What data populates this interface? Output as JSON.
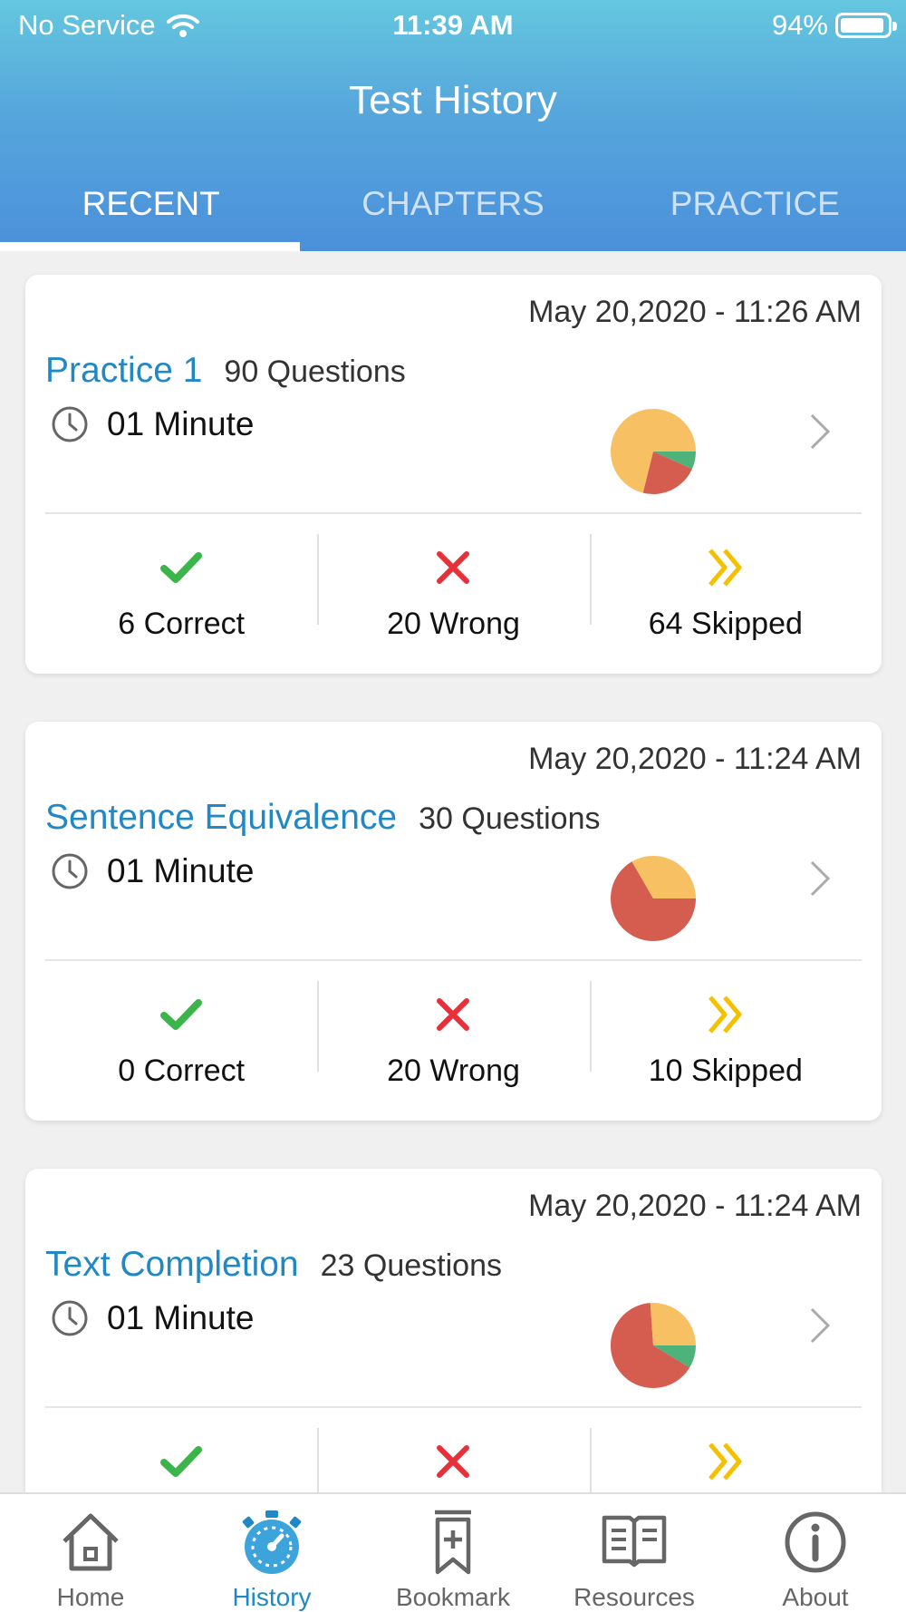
{
  "status": {
    "carrier": "No Service",
    "time": "11:39 AM",
    "battery": "94%",
    "battery_level": 0.94
  },
  "header": {
    "title": "Test History"
  },
  "tabs": [
    {
      "label": "RECENT",
      "active": true
    },
    {
      "label": "CHAPTERS",
      "active": false
    },
    {
      "label": "PRACTICE",
      "active": false
    }
  ],
  "colors": {
    "correct": "#3bb54a",
    "wrong": "#e8303b",
    "skipped": "#f5c000",
    "pie_skipped": "#f6c063",
    "pie_wrong": "#d55d4f",
    "pie_correct": "#4db37a",
    "accent": "#2188c6"
  },
  "tests": [
    {
      "date": "May 20,2020 - 11:26 AM",
      "name": "Practice 1",
      "questions": "90 Questions",
      "duration": "01 Minute",
      "correct_label": "6 Correct",
      "wrong_label": "20 Wrong",
      "skipped_label": "64 Skipped",
      "correct": 6,
      "wrong": 20,
      "skipped": 64
    },
    {
      "date": "May 20,2020 - 11:24 AM",
      "name": "Sentence Equivalence",
      "questions": "30 Questions",
      "duration": "01 Minute",
      "correct_label": "0 Correct",
      "wrong_label": "20 Wrong",
      "skipped_label": "10 Skipped",
      "correct": 0,
      "wrong": 20,
      "skipped": 10
    },
    {
      "date": "May 20,2020 - 11:24 AM",
      "name": "Text Completion",
      "questions": "23 Questions",
      "duration": "01 Minute",
      "correct_label": "",
      "wrong_label": "",
      "skipped_label": "",
      "correct": 2,
      "wrong": 15,
      "skipped": 6
    }
  ],
  "nav": [
    {
      "label": "Home",
      "icon": "home-icon",
      "active": false
    },
    {
      "label": "History",
      "icon": "stopwatch-icon",
      "active": true
    },
    {
      "label": "Bookmark",
      "icon": "bookmark-icon",
      "active": false
    },
    {
      "label": "Resources",
      "icon": "book-icon",
      "active": false
    },
    {
      "label": "About",
      "icon": "info-icon",
      "active": false
    }
  ]
}
